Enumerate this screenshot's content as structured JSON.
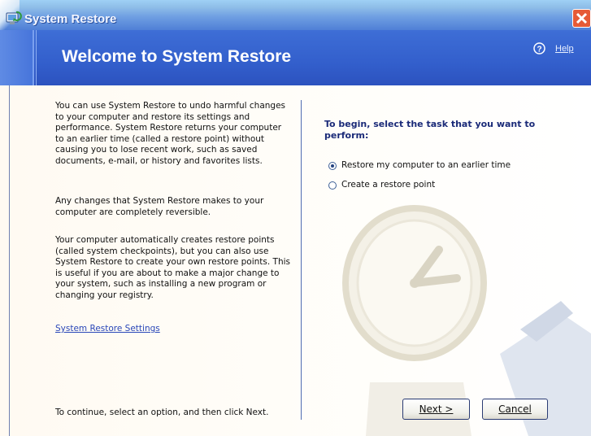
{
  "window": {
    "title": "System Restore",
    "header_title": "Welcome to System Restore",
    "help_label": "Help"
  },
  "left_panel": {
    "paragraph1": "You can use System Restore to undo harmful changes to your computer and restore its settings and performance. System Restore returns your computer to an earlier time (called a restore point) without causing you to lose recent work, such as saved documents, e-mail, or history and favorites lists.",
    "paragraph2": "Any changes that System Restore makes to your computer are completely reversible.",
    "paragraph3": "Your computer automatically creates restore points (called system checkpoints), but you can also use System Restore to create your own restore points. This is useful if you are about to make a major change to your system, such as installing a new program or changing your registry.",
    "settings_link": "System Restore Settings",
    "bottom_note": "To continue, select an option, and then click Next."
  },
  "right_panel": {
    "prompt": "To begin, select the task that you want to perform:",
    "options": [
      {
        "label": "Restore my computer to an earlier time",
        "selected": true
      },
      {
        "label": "Create a restore point",
        "selected": false
      }
    ]
  },
  "buttons": {
    "next": "Next >",
    "cancel": "Cancel"
  },
  "icons": {
    "app": "system-restore-icon",
    "help": "help-icon",
    "close": "close-icon",
    "watermark": "clock-icon"
  },
  "colors": {
    "header_blue": "#335fcc",
    "link_blue": "#2a47b8",
    "close_red": "#e65a36",
    "prompt_navy": "#1a2a78"
  }
}
